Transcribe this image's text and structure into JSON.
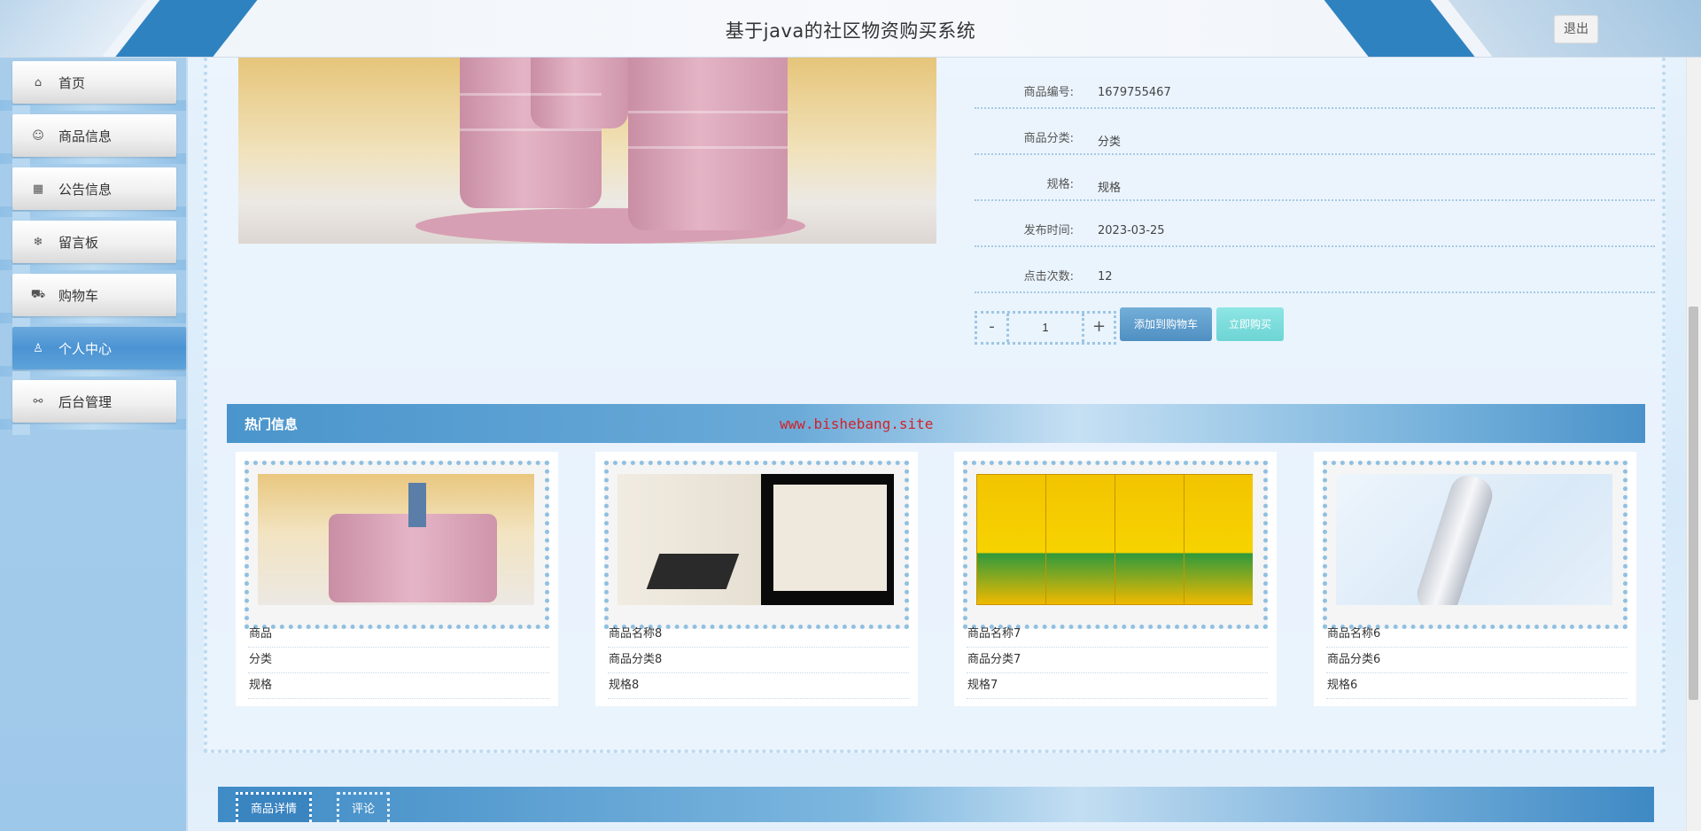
{
  "header": {
    "title": "基于java的社区物资购买系统",
    "logout_label": "退出"
  },
  "sidebar": {
    "items": [
      {
        "label": "首页",
        "icon": "home-icon",
        "glyph": "⌂"
      },
      {
        "label": "商品信息",
        "icon": "product-icon",
        "glyph": "☺"
      },
      {
        "label": "公告信息",
        "icon": "notice-icon",
        "glyph": "▦"
      },
      {
        "label": "留言板",
        "icon": "snowflake-icon",
        "glyph": "❄"
      },
      {
        "label": "购物车",
        "icon": "cart-icon",
        "glyph": "⛟"
      },
      {
        "label": "个人中心",
        "icon": "user-icon",
        "glyph": "♙"
      },
      {
        "label": "后台管理",
        "icon": "link-icon",
        "glyph": "⚯"
      }
    ],
    "active_index": 5
  },
  "detail": {
    "fields": [
      {
        "key": "商品编号:",
        "value": "1679755467"
      },
      {
        "key": "商品分类:",
        "value": "分类"
      },
      {
        "key": "规格:",
        "value": "规格"
      },
      {
        "key": "发布时间:",
        "value": "2023-03-25"
      },
      {
        "key": "点击次数:",
        "value": "12"
      }
    ],
    "quantity": "1",
    "minus_label": "-",
    "plus_label": "+",
    "add_cart_label": "添加到购物车",
    "buy_now_label": "立即购买"
  },
  "hot": {
    "title": "热门信息",
    "watermark": "www.bishebang.site",
    "cards": [
      {
        "name": "商品",
        "category": "分类",
        "spec": "规格"
      },
      {
        "name": "商品名称8",
        "category": "商品分类8",
        "spec": "规格8"
      },
      {
        "name": "商品名称7",
        "category": "商品分类7",
        "spec": "规格7"
      },
      {
        "name": "商品名称6",
        "category": "商品分类6",
        "spec": "规格6"
      }
    ]
  },
  "tabs": [
    {
      "label": "商品详情"
    },
    {
      "label": "评论"
    }
  ],
  "colors": {
    "accent": "#4a95cc",
    "sidebar_bg": "#a8cdeb",
    "active_nav": "#4b93d3",
    "watermark": "#d0232a"
  }
}
